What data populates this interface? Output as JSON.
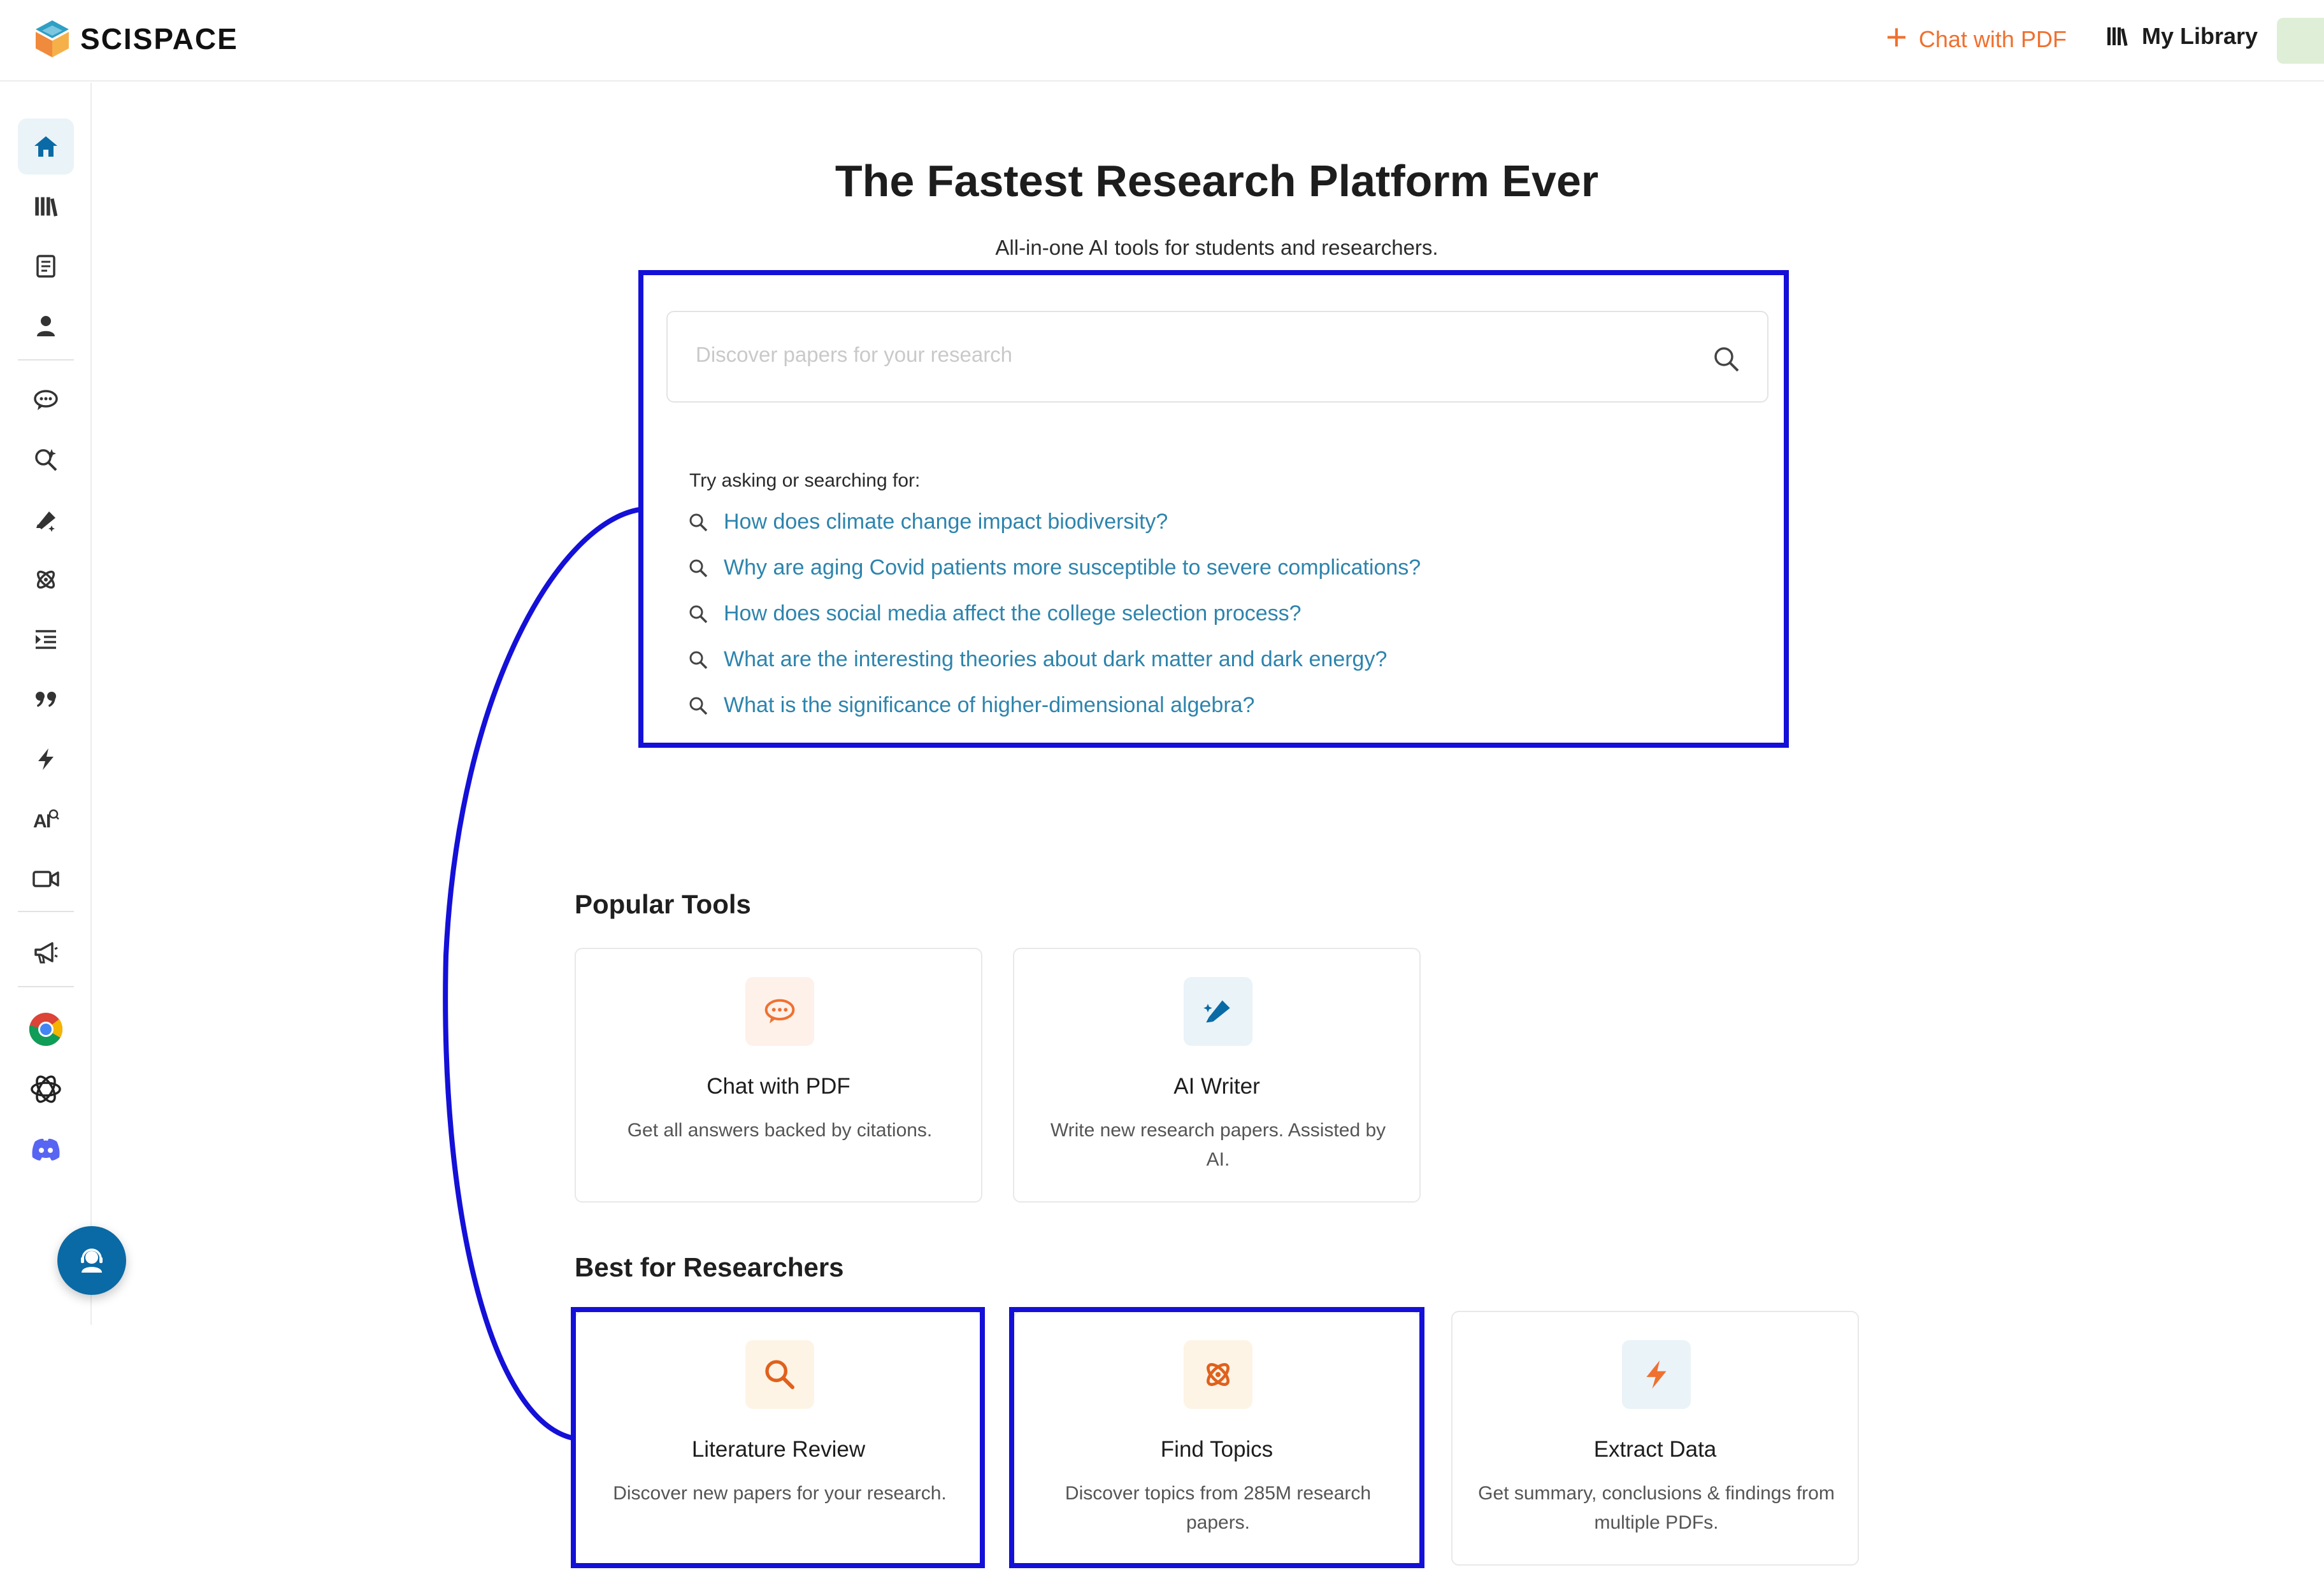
{
  "header": {
    "logo_text": "SCISPACE",
    "chat_with_pdf_label": "Chat with PDF",
    "my_library_label": "My Library"
  },
  "sidebar": {
    "items": [
      {
        "icon": "home-icon",
        "active": true
      },
      {
        "icon": "library-icon"
      },
      {
        "icon": "notebook-icon"
      },
      {
        "icon": "user-icon"
      },
      {
        "icon": "chat-icon"
      },
      {
        "icon": "literature-search-icon"
      },
      {
        "icon": "ai-writer-icon"
      },
      {
        "icon": "atom-icon"
      },
      {
        "icon": "paraphrase-list-icon"
      },
      {
        "icon": "quote-icon"
      },
      {
        "icon": "extract-bolt-icon"
      },
      {
        "icon": "ai-detector-icon"
      },
      {
        "icon": "video-icon"
      },
      {
        "icon": "megaphone-icon"
      },
      {
        "icon": "chrome-icon"
      },
      {
        "icon": "openai-icon"
      },
      {
        "icon": "discord-icon"
      }
    ],
    "fab_icon": "support-agent-icon"
  },
  "hero": {
    "title": "The Fastest Research Platform Ever",
    "subtitle": "All-in-one AI tools for students and researchers."
  },
  "search": {
    "placeholder": "Discover papers for your research",
    "value": "",
    "try_label": "Try asking or searching for:",
    "suggestions": [
      "How does climate change impact biodiversity?",
      "Why are aging Covid patients more susceptible to severe complications?",
      "How does social media affect the college selection process?",
      "What are the interesting theories about dark matter and dark energy?",
      "What is the significance of higher-dimensional algebra?"
    ]
  },
  "popular_tools": {
    "title": "Popular Tools",
    "cards": [
      {
        "title": "Chat with PDF",
        "desc": "Get all answers backed by citations.",
        "icon": "chat-bubble-icon"
      },
      {
        "title": "AI Writer",
        "desc": "Write new research papers. Assisted by AI.",
        "icon": "pen-icon"
      }
    ]
  },
  "best_for_researchers": {
    "title": "Best for Researchers",
    "cards": [
      {
        "title": "Literature Review",
        "desc": "Discover new papers for your research.",
        "icon": "search-icon"
      },
      {
        "title": "Find Topics",
        "desc": "Discover topics from 285M research papers.",
        "icon": "atom-icon"
      },
      {
        "title": "Extract Data",
        "desc": "Get summary, conclusions & findings from multiple PDFs.",
        "icon": "bolt-icon"
      }
    ]
  },
  "colors": {
    "accent_orange": "#f0702f",
    "link_blue": "#2d84ad",
    "annotation_blue": "#1410d8",
    "brand_dark_blue": "#0a6aa6"
  }
}
